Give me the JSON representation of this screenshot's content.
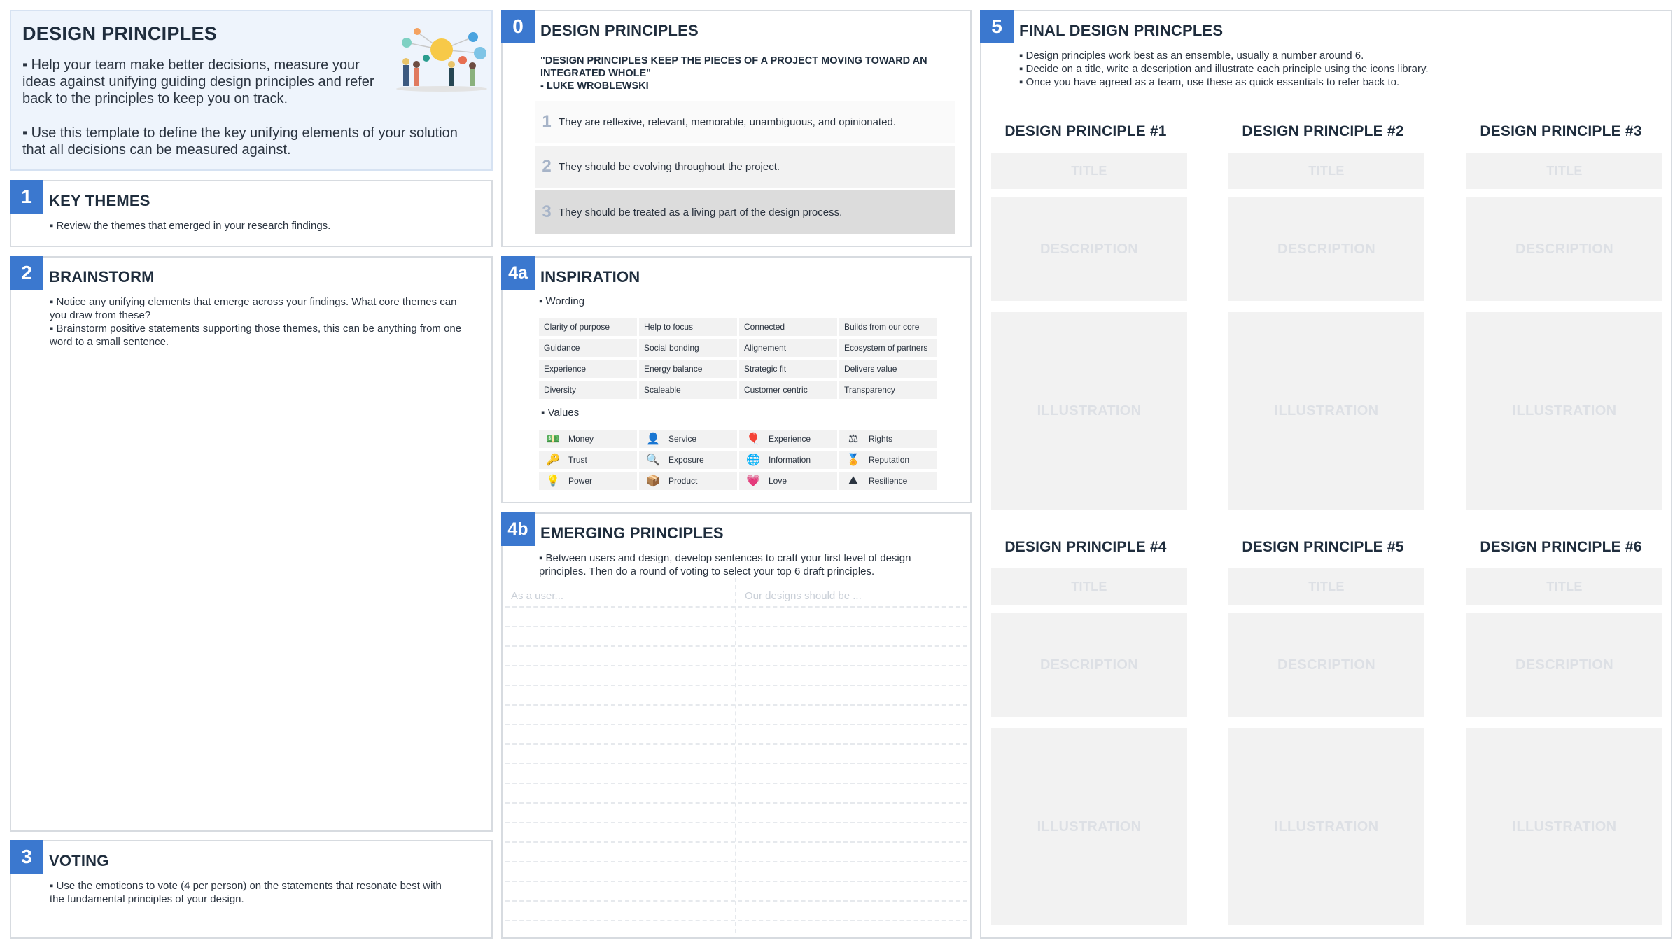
{
  "intro": {
    "title": "DESIGN PRINCIPLES",
    "para1": "▪ Help your team make better decisions, measure your ideas against unifying guiding design principles and refer back to the principles to keep you on track.",
    "para2": "▪ Use this template to define the key unifying elements of your solution that all decisions can be measured against."
  },
  "key_themes": {
    "num": "1",
    "title": "KEY THEMES",
    "bullets": [
      "▪ Review the themes that emerged in your research findings."
    ]
  },
  "brainstorm": {
    "num": "2",
    "title": "BRAINSTORM",
    "bullets": [
      "▪ Notice any unifying elements that emerge across your findings. What core themes can you draw from these?",
      "▪ Brainstorm positive statements supporting those themes, this can be anything from one word to a small sentence."
    ]
  },
  "voting": {
    "num": "3",
    "title": "VOTING",
    "bullets": [
      "▪ Use the emoticons to vote (4 per person) on the statements that resonate best with the fundamental principles of your design."
    ]
  },
  "panel0": {
    "num": "0",
    "title": "DESIGN PRINCIPLES",
    "quote": "\"DESIGN PRINCIPLES KEEP THE PIECES OF A PROJECT MOVING TOWARD AN INTEGRATED WHOLE\"",
    "author": "- LUKE WROBLEWSKI",
    "rules": [
      {
        "num": "1",
        "text": "They are reflexive, relevant, memorable, unambiguous, and opinionated."
      },
      {
        "num": "2",
        "text": "They should be evolving throughout the project."
      },
      {
        "num": "3",
        "text": "They should be treated as a living part of the design process."
      }
    ]
  },
  "inspiration": {
    "num": "4a",
    "title": "INSPIRATION",
    "wording_label": "▪ Wording",
    "values_label": "▪ Values",
    "wording": [
      "Clarity of purpose",
      "Help to focus",
      "Connected",
      "Builds from our core",
      "Guidance",
      "Social bonding",
      "Alignement",
      "Ecosystem of partners",
      "Experience",
      "Energy balance",
      "Strategic fit",
      "Delivers value",
      "Diversity",
      "Scaleable",
      "Customer centric",
      "Transparency"
    ],
    "values": [
      {
        "label": "Money",
        "icon": "money-icon",
        "glyph": "💵"
      },
      {
        "label": "Service",
        "icon": "service-icon",
        "glyph": "👤"
      },
      {
        "label": "Experience",
        "icon": "balloon-icon",
        "glyph": "🎈"
      },
      {
        "label": "Rights",
        "icon": "scales-icon",
        "glyph": "⚖"
      },
      {
        "label": "Trust",
        "icon": "key-icon",
        "glyph": "🔑"
      },
      {
        "label": "Exposure",
        "icon": "magnifier-icon",
        "glyph": "🔍"
      },
      {
        "label": "Information",
        "icon": "globe-icon",
        "glyph": "🌐"
      },
      {
        "label": "Reputation",
        "icon": "medal-icon",
        "glyph": "🏅"
      },
      {
        "label": "Power",
        "icon": "lightbulb-icon",
        "glyph": "💡"
      },
      {
        "label": "Product",
        "icon": "box-icon",
        "glyph": "📦"
      },
      {
        "label": "Love",
        "icon": "heart-icon",
        "glyph": "💗"
      },
      {
        "label": "Resilience",
        "icon": "sand-icon",
        "glyph": "⛰"
      }
    ]
  },
  "emerging": {
    "num": "4b",
    "title": "EMERGING PRINCIPLES",
    "text": "▪ Between users and design, develop sentences to craft your first level of design principles. Then do a round of voting to select your top 6 draft principles.",
    "col1_placeholder": "As a user...",
    "col2_placeholder": "Our designs should be ..."
  },
  "final": {
    "num": "5",
    "title": "FINAL DESIGN PRINCPLES",
    "bullets": [
      "▪ Design principles work best as an ensemble, usually a number around 6.",
      "▪ Decide on a title, write a description and illustrate each principle using the icons library.",
      "▪ Once you have agreed as a team, use these as quick essentials to refer back to."
    ],
    "principles": [
      {
        "heading": "DESIGN PRINCIPLE #1",
        "title": "TITLE",
        "description": "DESCRIPTION",
        "illustration": "ILLUSTRATION"
      },
      {
        "heading": "DESIGN PRINCIPLE #2",
        "title": "TITLE",
        "description": "DESCRIPTION",
        "illustration": "ILLUSTRATION"
      },
      {
        "heading": "DESIGN PRINCIPLE #3",
        "title": "TITLE",
        "description": "DESCRIPTION",
        "illustration": "ILLUSTRATION"
      },
      {
        "heading": "DESIGN PRINCIPLE #4",
        "title": "TITLE",
        "description": "DESCRIPTION",
        "illustration": "ILLUSTRATION"
      },
      {
        "heading": "DESIGN PRINCIPLE #5",
        "title": "TITLE",
        "description": "DESCRIPTION",
        "illustration": "ILLUSTRATION"
      },
      {
        "heading": "DESIGN PRINCIPLE #6",
        "title": "TITLE",
        "description": "DESCRIPTION",
        "illustration": "ILLUSTRATION"
      }
    ]
  },
  "colors": {
    "accent": "#3b78cf",
    "placeholder_fill": "#f2f2f2",
    "intro_bg": "#eef4fc",
    "highlight_row": "#dcdcdc"
  }
}
